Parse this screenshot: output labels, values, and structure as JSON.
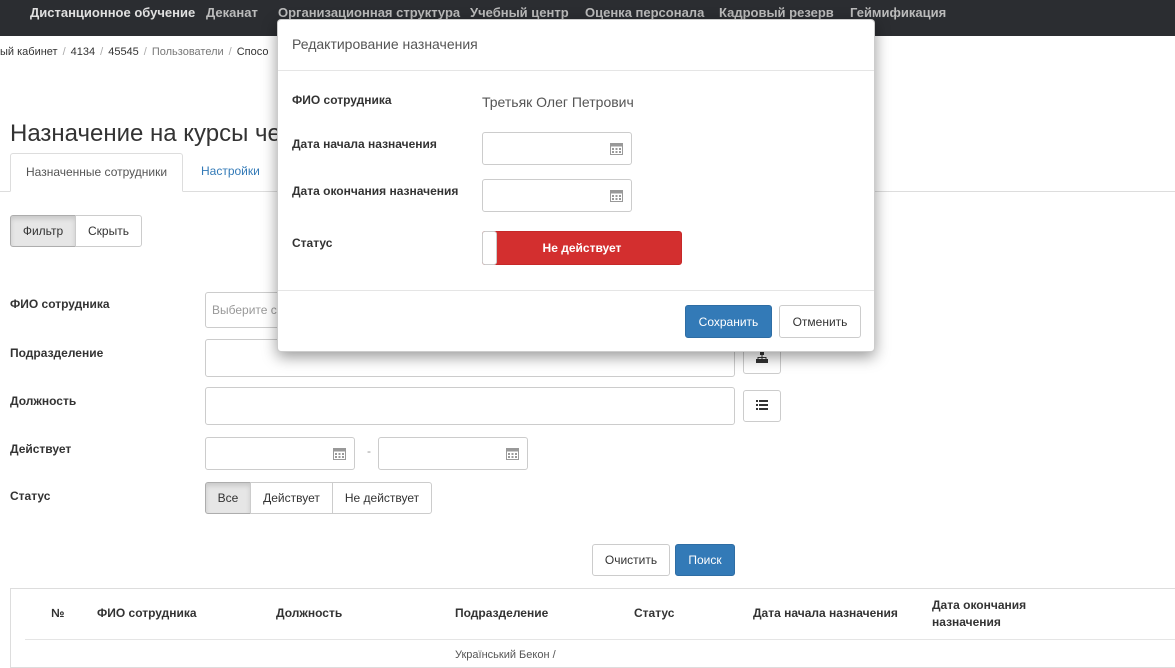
{
  "nav": {
    "items": [
      "Дистанционное обучение",
      "Деканат",
      "Организационная структура",
      "Учебный центр",
      "Оценка персонала",
      "Кадровый резерв",
      "Геймификация"
    ]
  },
  "breadcrumb": [
    "ый кабинет",
    "4134",
    "45545",
    "Пользователи",
    "Спосо"
  ],
  "page": {
    "title": "Назначение на курсы че"
  },
  "tabs": {
    "active": "Назначенные сотрудники",
    "settings": "Настройки"
  },
  "filter": {
    "filter_btn": "Фильтр",
    "hide_btn": "Скрыть",
    "employee_label": "ФИО сотрудника",
    "employee_placeholder": "Выберите с",
    "division_label": "Подразделение",
    "position_label": "Должность",
    "active_label": "Действует",
    "status_label": "Статус",
    "status_options": [
      "Все",
      "Действует",
      "Не действует"
    ],
    "clear_btn": "Очистить",
    "search_btn": "Поиск"
  },
  "table": {
    "headers": [
      "№",
      "ФИО сотрудника",
      "Должность",
      "Подразделение",
      "Статус",
      "Дата начала назначения",
      "Дата окончания назначения"
    ],
    "partial_cell": "Український Бекон /"
  },
  "modal": {
    "title": "Редактирование назначения",
    "employee_label": "ФИО сотрудника",
    "employee_value": "Третьяк Олег Петрович",
    "start_label": "Дата начала назначения",
    "end_label": "Дата окончания назначения",
    "status_label": "Статус",
    "status_value": "Не действует",
    "save_btn": "Сохранить",
    "cancel_btn": "Отменить"
  },
  "colors": {
    "nav_bg": "#2b2d31",
    "primary": "#337ab7",
    "danger": "#d32f2f"
  }
}
